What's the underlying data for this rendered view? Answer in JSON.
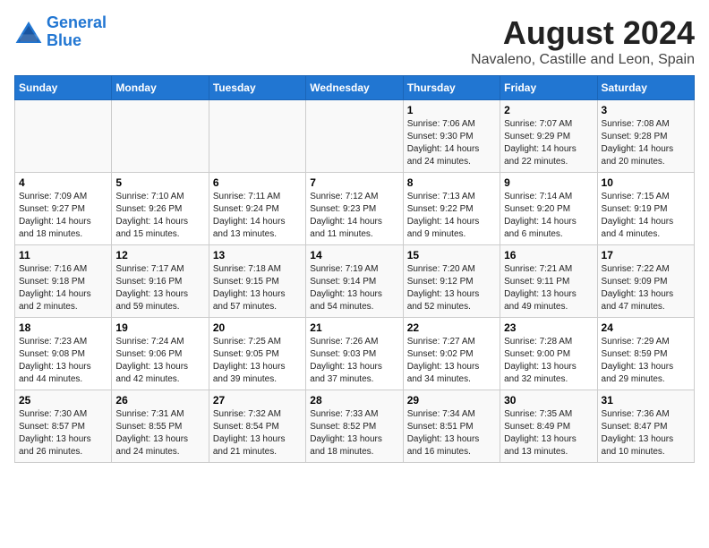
{
  "logo": {
    "line1": "General",
    "line2": "Blue"
  },
  "title": "August 2024",
  "subtitle": "Navaleno, Castille and Leon, Spain",
  "weekdays": [
    "Sunday",
    "Monday",
    "Tuesday",
    "Wednesday",
    "Thursday",
    "Friday",
    "Saturday"
  ],
  "weeks": [
    [
      {
        "day": "",
        "info": ""
      },
      {
        "day": "",
        "info": ""
      },
      {
        "day": "",
        "info": ""
      },
      {
        "day": "",
        "info": ""
      },
      {
        "day": "1",
        "info": "Sunrise: 7:06 AM\nSunset: 9:30 PM\nDaylight: 14 hours and 24 minutes."
      },
      {
        "day": "2",
        "info": "Sunrise: 7:07 AM\nSunset: 9:29 PM\nDaylight: 14 hours and 22 minutes."
      },
      {
        "day": "3",
        "info": "Sunrise: 7:08 AM\nSunset: 9:28 PM\nDaylight: 14 hours and 20 minutes."
      }
    ],
    [
      {
        "day": "4",
        "info": "Sunrise: 7:09 AM\nSunset: 9:27 PM\nDaylight: 14 hours and 18 minutes."
      },
      {
        "day": "5",
        "info": "Sunrise: 7:10 AM\nSunset: 9:26 PM\nDaylight: 14 hours and 15 minutes."
      },
      {
        "day": "6",
        "info": "Sunrise: 7:11 AM\nSunset: 9:24 PM\nDaylight: 14 hours and 13 minutes."
      },
      {
        "day": "7",
        "info": "Sunrise: 7:12 AM\nSunset: 9:23 PM\nDaylight: 14 hours and 11 minutes."
      },
      {
        "day": "8",
        "info": "Sunrise: 7:13 AM\nSunset: 9:22 PM\nDaylight: 14 hours and 9 minutes."
      },
      {
        "day": "9",
        "info": "Sunrise: 7:14 AM\nSunset: 9:20 PM\nDaylight: 14 hours and 6 minutes."
      },
      {
        "day": "10",
        "info": "Sunrise: 7:15 AM\nSunset: 9:19 PM\nDaylight: 14 hours and 4 minutes."
      }
    ],
    [
      {
        "day": "11",
        "info": "Sunrise: 7:16 AM\nSunset: 9:18 PM\nDaylight: 14 hours and 2 minutes."
      },
      {
        "day": "12",
        "info": "Sunrise: 7:17 AM\nSunset: 9:16 PM\nDaylight: 13 hours and 59 minutes."
      },
      {
        "day": "13",
        "info": "Sunrise: 7:18 AM\nSunset: 9:15 PM\nDaylight: 13 hours and 57 minutes."
      },
      {
        "day": "14",
        "info": "Sunrise: 7:19 AM\nSunset: 9:14 PM\nDaylight: 13 hours and 54 minutes."
      },
      {
        "day": "15",
        "info": "Sunrise: 7:20 AM\nSunset: 9:12 PM\nDaylight: 13 hours and 52 minutes."
      },
      {
        "day": "16",
        "info": "Sunrise: 7:21 AM\nSunset: 9:11 PM\nDaylight: 13 hours and 49 minutes."
      },
      {
        "day": "17",
        "info": "Sunrise: 7:22 AM\nSunset: 9:09 PM\nDaylight: 13 hours and 47 minutes."
      }
    ],
    [
      {
        "day": "18",
        "info": "Sunrise: 7:23 AM\nSunset: 9:08 PM\nDaylight: 13 hours and 44 minutes."
      },
      {
        "day": "19",
        "info": "Sunrise: 7:24 AM\nSunset: 9:06 PM\nDaylight: 13 hours and 42 minutes."
      },
      {
        "day": "20",
        "info": "Sunrise: 7:25 AM\nSunset: 9:05 PM\nDaylight: 13 hours and 39 minutes."
      },
      {
        "day": "21",
        "info": "Sunrise: 7:26 AM\nSunset: 9:03 PM\nDaylight: 13 hours and 37 minutes."
      },
      {
        "day": "22",
        "info": "Sunrise: 7:27 AM\nSunset: 9:02 PM\nDaylight: 13 hours and 34 minutes."
      },
      {
        "day": "23",
        "info": "Sunrise: 7:28 AM\nSunset: 9:00 PM\nDaylight: 13 hours and 32 minutes."
      },
      {
        "day": "24",
        "info": "Sunrise: 7:29 AM\nSunset: 8:59 PM\nDaylight: 13 hours and 29 minutes."
      }
    ],
    [
      {
        "day": "25",
        "info": "Sunrise: 7:30 AM\nSunset: 8:57 PM\nDaylight: 13 hours and 26 minutes."
      },
      {
        "day": "26",
        "info": "Sunrise: 7:31 AM\nSunset: 8:55 PM\nDaylight: 13 hours and 24 minutes."
      },
      {
        "day": "27",
        "info": "Sunrise: 7:32 AM\nSunset: 8:54 PM\nDaylight: 13 hours and 21 minutes."
      },
      {
        "day": "28",
        "info": "Sunrise: 7:33 AM\nSunset: 8:52 PM\nDaylight: 13 hours and 18 minutes."
      },
      {
        "day": "29",
        "info": "Sunrise: 7:34 AM\nSunset: 8:51 PM\nDaylight: 13 hours and 16 minutes."
      },
      {
        "day": "30",
        "info": "Sunrise: 7:35 AM\nSunset: 8:49 PM\nDaylight: 13 hours and 13 minutes."
      },
      {
        "day": "31",
        "info": "Sunrise: 7:36 AM\nSunset: 8:47 PM\nDaylight: 13 hours and 10 minutes."
      }
    ]
  ]
}
